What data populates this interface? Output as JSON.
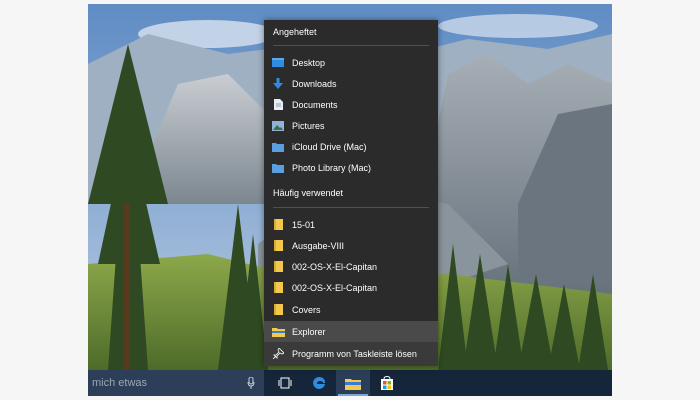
{
  "jumplist": {
    "pinned_title": "Angeheftet",
    "pinned": [
      {
        "label": "Desktop",
        "icon": "desktop-folder-icon"
      },
      {
        "label": "Downloads",
        "icon": "download-arrow-icon"
      },
      {
        "label": "Documents",
        "icon": "document-icon"
      },
      {
        "label": "Pictures",
        "icon": "pictures-icon"
      },
      {
        "label": "iCloud Drive (Mac)",
        "icon": "folder-icon"
      },
      {
        "label": "Photo Library (Mac)",
        "icon": "folder-icon"
      }
    ],
    "frequent_title": "Häufig verwendet",
    "frequent": [
      {
        "label": "15-01",
        "icon": "folder-icon"
      },
      {
        "label": "Ausgabe-VIII",
        "icon": "folder-icon"
      },
      {
        "label": "002-OS-X-El-Capitan",
        "icon": "folder-icon"
      },
      {
        "label": "002-OS-X-El-Capitan",
        "icon": "folder-icon"
      },
      {
        "label": "Covers",
        "icon": "folder-icon"
      }
    ],
    "actions": [
      {
        "label": "Explorer",
        "icon": "file-explorer-icon"
      },
      {
        "label": "Programm von Taskleiste lösen",
        "icon": "unpin-icon"
      }
    ]
  },
  "taskbar": {
    "search_placeholder": "mich etwas",
    "apps": [
      "task-view-icon",
      "edge-icon",
      "file-explorer-icon",
      "store-icon"
    ]
  },
  "colors": {
    "menu_bg": "#2b2b2b",
    "menu_action_bg": "#3a3a3a",
    "taskbar_bg": "#15253a",
    "folder_yellow": "#f2c94c",
    "accent_blue": "#2e8de0"
  }
}
